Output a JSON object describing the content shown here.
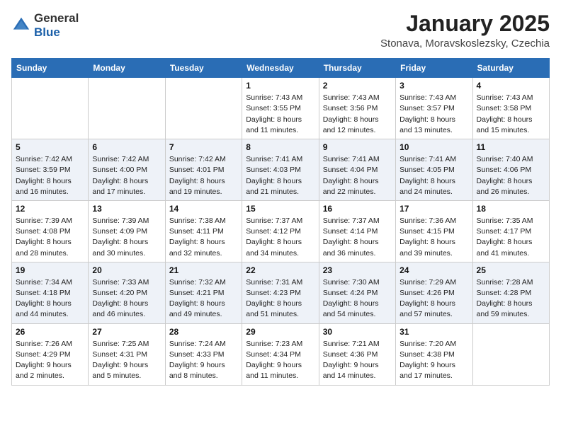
{
  "header": {
    "logo_general": "General",
    "logo_blue": "Blue",
    "month": "January 2025",
    "location": "Stonava, Moravskoslezsky, Czechia"
  },
  "weekdays": [
    "Sunday",
    "Monday",
    "Tuesday",
    "Wednesday",
    "Thursday",
    "Friday",
    "Saturday"
  ],
  "weeks": [
    [
      {
        "day": "",
        "sunrise": "",
        "sunset": "",
        "daylight": ""
      },
      {
        "day": "",
        "sunrise": "",
        "sunset": "",
        "daylight": ""
      },
      {
        "day": "",
        "sunrise": "",
        "sunset": "",
        "daylight": ""
      },
      {
        "day": "1",
        "sunrise": "Sunrise: 7:43 AM",
        "sunset": "Sunset: 3:55 PM",
        "daylight": "Daylight: 8 hours and 11 minutes."
      },
      {
        "day": "2",
        "sunrise": "Sunrise: 7:43 AM",
        "sunset": "Sunset: 3:56 PM",
        "daylight": "Daylight: 8 hours and 12 minutes."
      },
      {
        "day": "3",
        "sunrise": "Sunrise: 7:43 AM",
        "sunset": "Sunset: 3:57 PM",
        "daylight": "Daylight: 8 hours and 13 minutes."
      },
      {
        "day": "4",
        "sunrise": "Sunrise: 7:43 AM",
        "sunset": "Sunset: 3:58 PM",
        "daylight": "Daylight: 8 hours and 15 minutes."
      }
    ],
    [
      {
        "day": "5",
        "sunrise": "Sunrise: 7:42 AM",
        "sunset": "Sunset: 3:59 PM",
        "daylight": "Daylight: 8 hours and 16 minutes."
      },
      {
        "day": "6",
        "sunrise": "Sunrise: 7:42 AM",
        "sunset": "Sunset: 4:00 PM",
        "daylight": "Daylight: 8 hours and 17 minutes."
      },
      {
        "day": "7",
        "sunrise": "Sunrise: 7:42 AM",
        "sunset": "Sunset: 4:01 PM",
        "daylight": "Daylight: 8 hours and 19 minutes."
      },
      {
        "day": "8",
        "sunrise": "Sunrise: 7:41 AM",
        "sunset": "Sunset: 4:03 PM",
        "daylight": "Daylight: 8 hours and 21 minutes."
      },
      {
        "day": "9",
        "sunrise": "Sunrise: 7:41 AM",
        "sunset": "Sunset: 4:04 PM",
        "daylight": "Daylight: 8 hours and 22 minutes."
      },
      {
        "day": "10",
        "sunrise": "Sunrise: 7:41 AM",
        "sunset": "Sunset: 4:05 PM",
        "daylight": "Daylight: 8 hours and 24 minutes."
      },
      {
        "day": "11",
        "sunrise": "Sunrise: 7:40 AM",
        "sunset": "Sunset: 4:06 PM",
        "daylight": "Daylight: 8 hours and 26 minutes."
      }
    ],
    [
      {
        "day": "12",
        "sunrise": "Sunrise: 7:39 AM",
        "sunset": "Sunset: 4:08 PM",
        "daylight": "Daylight: 8 hours and 28 minutes."
      },
      {
        "day": "13",
        "sunrise": "Sunrise: 7:39 AM",
        "sunset": "Sunset: 4:09 PM",
        "daylight": "Daylight: 8 hours and 30 minutes."
      },
      {
        "day": "14",
        "sunrise": "Sunrise: 7:38 AM",
        "sunset": "Sunset: 4:11 PM",
        "daylight": "Daylight: 8 hours and 32 minutes."
      },
      {
        "day": "15",
        "sunrise": "Sunrise: 7:37 AM",
        "sunset": "Sunset: 4:12 PM",
        "daylight": "Daylight: 8 hours and 34 minutes."
      },
      {
        "day": "16",
        "sunrise": "Sunrise: 7:37 AM",
        "sunset": "Sunset: 4:14 PM",
        "daylight": "Daylight: 8 hours and 36 minutes."
      },
      {
        "day": "17",
        "sunrise": "Sunrise: 7:36 AM",
        "sunset": "Sunset: 4:15 PM",
        "daylight": "Daylight: 8 hours and 39 minutes."
      },
      {
        "day": "18",
        "sunrise": "Sunrise: 7:35 AM",
        "sunset": "Sunset: 4:17 PM",
        "daylight": "Daylight: 8 hours and 41 minutes."
      }
    ],
    [
      {
        "day": "19",
        "sunrise": "Sunrise: 7:34 AM",
        "sunset": "Sunset: 4:18 PM",
        "daylight": "Daylight: 8 hours and 44 minutes."
      },
      {
        "day": "20",
        "sunrise": "Sunrise: 7:33 AM",
        "sunset": "Sunset: 4:20 PM",
        "daylight": "Daylight: 8 hours and 46 minutes."
      },
      {
        "day": "21",
        "sunrise": "Sunrise: 7:32 AM",
        "sunset": "Sunset: 4:21 PM",
        "daylight": "Daylight: 8 hours and 49 minutes."
      },
      {
        "day": "22",
        "sunrise": "Sunrise: 7:31 AM",
        "sunset": "Sunset: 4:23 PM",
        "daylight": "Daylight: 8 hours and 51 minutes."
      },
      {
        "day": "23",
        "sunrise": "Sunrise: 7:30 AM",
        "sunset": "Sunset: 4:24 PM",
        "daylight": "Daylight: 8 hours and 54 minutes."
      },
      {
        "day": "24",
        "sunrise": "Sunrise: 7:29 AM",
        "sunset": "Sunset: 4:26 PM",
        "daylight": "Daylight: 8 hours and 57 minutes."
      },
      {
        "day": "25",
        "sunrise": "Sunrise: 7:28 AM",
        "sunset": "Sunset: 4:28 PM",
        "daylight": "Daylight: 8 hours and 59 minutes."
      }
    ],
    [
      {
        "day": "26",
        "sunrise": "Sunrise: 7:26 AM",
        "sunset": "Sunset: 4:29 PM",
        "daylight": "Daylight: 9 hours and 2 minutes."
      },
      {
        "day": "27",
        "sunrise": "Sunrise: 7:25 AM",
        "sunset": "Sunset: 4:31 PM",
        "daylight": "Daylight: 9 hours and 5 minutes."
      },
      {
        "day": "28",
        "sunrise": "Sunrise: 7:24 AM",
        "sunset": "Sunset: 4:33 PM",
        "daylight": "Daylight: 9 hours and 8 minutes."
      },
      {
        "day": "29",
        "sunrise": "Sunrise: 7:23 AM",
        "sunset": "Sunset: 4:34 PM",
        "daylight": "Daylight: 9 hours and 11 minutes."
      },
      {
        "day": "30",
        "sunrise": "Sunrise: 7:21 AM",
        "sunset": "Sunset: 4:36 PM",
        "daylight": "Daylight: 9 hours and 14 minutes."
      },
      {
        "day": "31",
        "sunrise": "Sunrise: 7:20 AM",
        "sunset": "Sunset: 4:38 PM",
        "daylight": "Daylight: 9 hours and 17 minutes."
      },
      {
        "day": "",
        "sunrise": "",
        "sunset": "",
        "daylight": ""
      }
    ]
  ]
}
